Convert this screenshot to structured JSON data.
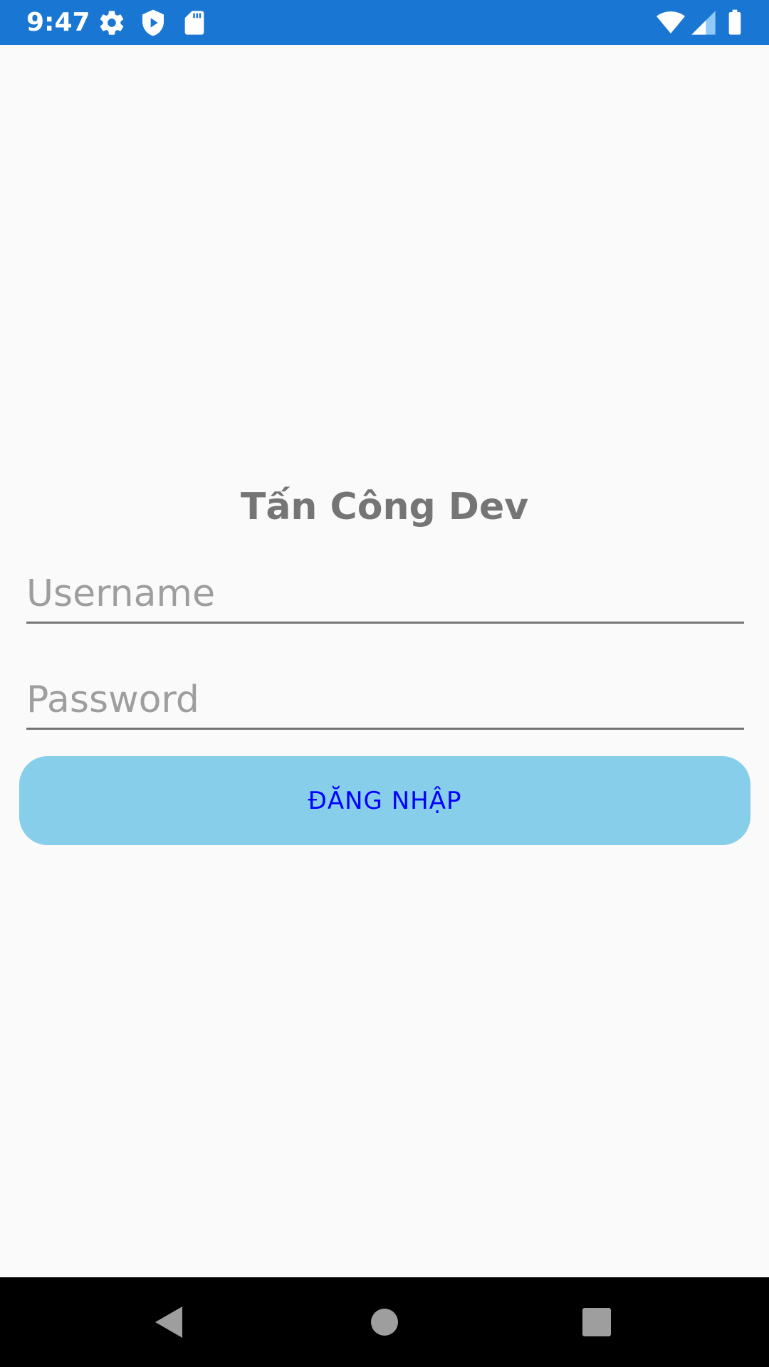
{
  "status_bar": {
    "time": "9:47",
    "background_color": "#1976d2",
    "left_icons": [
      "settings-icon",
      "shield-play-icon",
      "sd-card-icon"
    ],
    "right_icons": [
      "wifi-icon",
      "cell-signal-icon",
      "battery-icon"
    ]
  },
  "app": {
    "title": "Tấn Công Dev"
  },
  "form": {
    "username_placeholder": "Username",
    "username_value": "",
    "password_placeholder": "Password",
    "password_value": "",
    "login_label": "ĐĂNG NHẬP",
    "login_button_color": "#87ceeb",
    "login_text_color": "#0000ff"
  },
  "nav_bar": {
    "buttons": [
      "back-icon",
      "home-icon",
      "recents-icon"
    ]
  }
}
